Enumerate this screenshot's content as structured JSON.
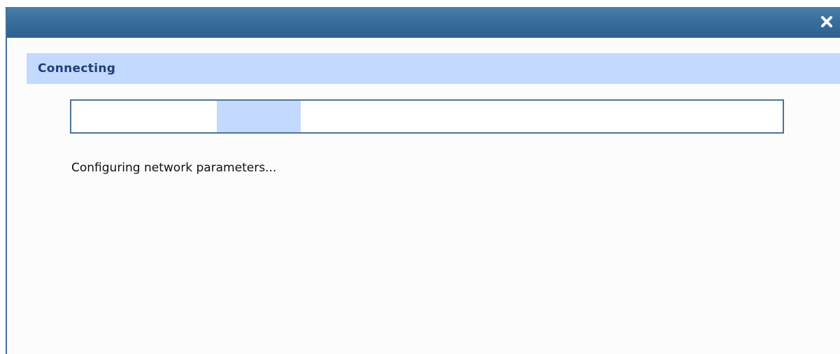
{
  "dialog": {
    "close_icon": "close-icon",
    "section_title": "Connecting",
    "progress": {
      "mode": "indeterminate",
      "chunk_start_fraction": 0.205,
      "chunk_width_fraction": 0.118
    },
    "status_message": "Configuring network parameters..."
  },
  "colors": {
    "titlebar": "#3a6e9c",
    "section_header_bg": "#c3d9fe",
    "section_title": "#1f3d78",
    "progress_border": "#4d7499",
    "progress_chunk": "#c3d9fe"
  }
}
